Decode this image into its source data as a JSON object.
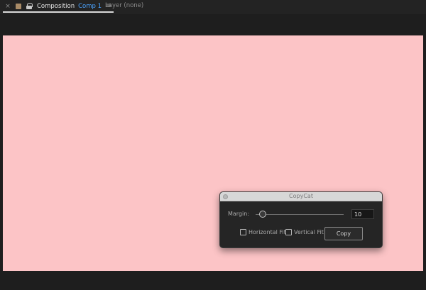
{
  "tabs": {
    "active": {
      "label": "Composition",
      "comp_name": "Comp 1",
      "close": "×",
      "menu": "≡"
    },
    "layer": {
      "label": "Layer (none)"
    }
  },
  "composition": {
    "background_color": "#fcc4c6"
  },
  "panel": {
    "title": "CopyCat",
    "margin_label": "Margin:",
    "margin_value": "10",
    "slider_fraction": 0.08,
    "horizontal_fit_label": "Horizontal Fit",
    "horizontal_fit_checked": false,
    "vertical_fit_label": "Vertical Fit",
    "vertical_fit_checked": false,
    "copy_label": "Copy"
  }
}
